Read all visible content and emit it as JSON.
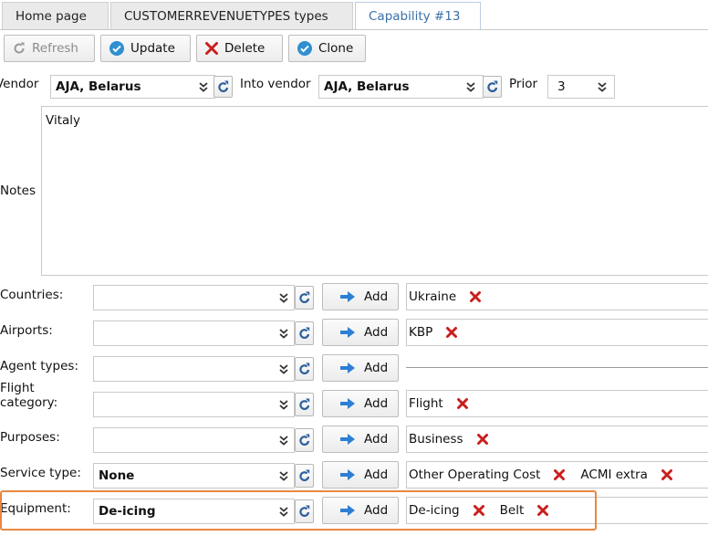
{
  "tabs": [
    {
      "label": "Home page",
      "active": false
    },
    {
      "label": "CUSTOMERREVENUETYPES types",
      "active": false
    },
    {
      "label": "Capability #13",
      "active": true
    }
  ],
  "toolbar": {
    "refresh": "Refresh",
    "update": "Update",
    "delete": "Delete",
    "clone": "Clone"
  },
  "header": {
    "vendor_label": "Vendor",
    "vendor_value": "AJA, Belarus",
    "into_vendor_label": "Into vendor",
    "into_vendor_value": "AJA, Belarus",
    "prior_label": "Prior",
    "prior_value": "3"
  },
  "notes": {
    "label": "Notes",
    "value": "Vitaly"
  },
  "add_label": "Add",
  "rows": [
    {
      "label": "Countries:",
      "value": "",
      "tags": [
        "Ukraine"
      ]
    },
    {
      "label": "Airports:",
      "value": "",
      "tags": [
        "KBP"
      ]
    },
    {
      "label": "Agent types:",
      "value": "",
      "tags": []
    },
    {
      "label_line1": "Flight",
      "label_line2": "category:",
      "value": "",
      "tags": [
        "Flight"
      ]
    },
    {
      "label": "Purposes:",
      "value": "",
      "tags": [
        "Business"
      ]
    },
    {
      "label": "Service type:",
      "value": "None",
      "tags": [
        "Other Operating Cost",
        "ACMI extra"
      ]
    },
    {
      "label": "Equipment:",
      "value": "De-icing",
      "tags": [
        "De-icing",
        "Belt"
      ]
    }
  ],
  "colors": {
    "active_tab_text": "#3a6fa8",
    "delete_red": "#c8201e",
    "ok_blue": "#2f8fd0",
    "arrow_blue": "#2d7fd3",
    "highlight": "#e8883f"
  }
}
